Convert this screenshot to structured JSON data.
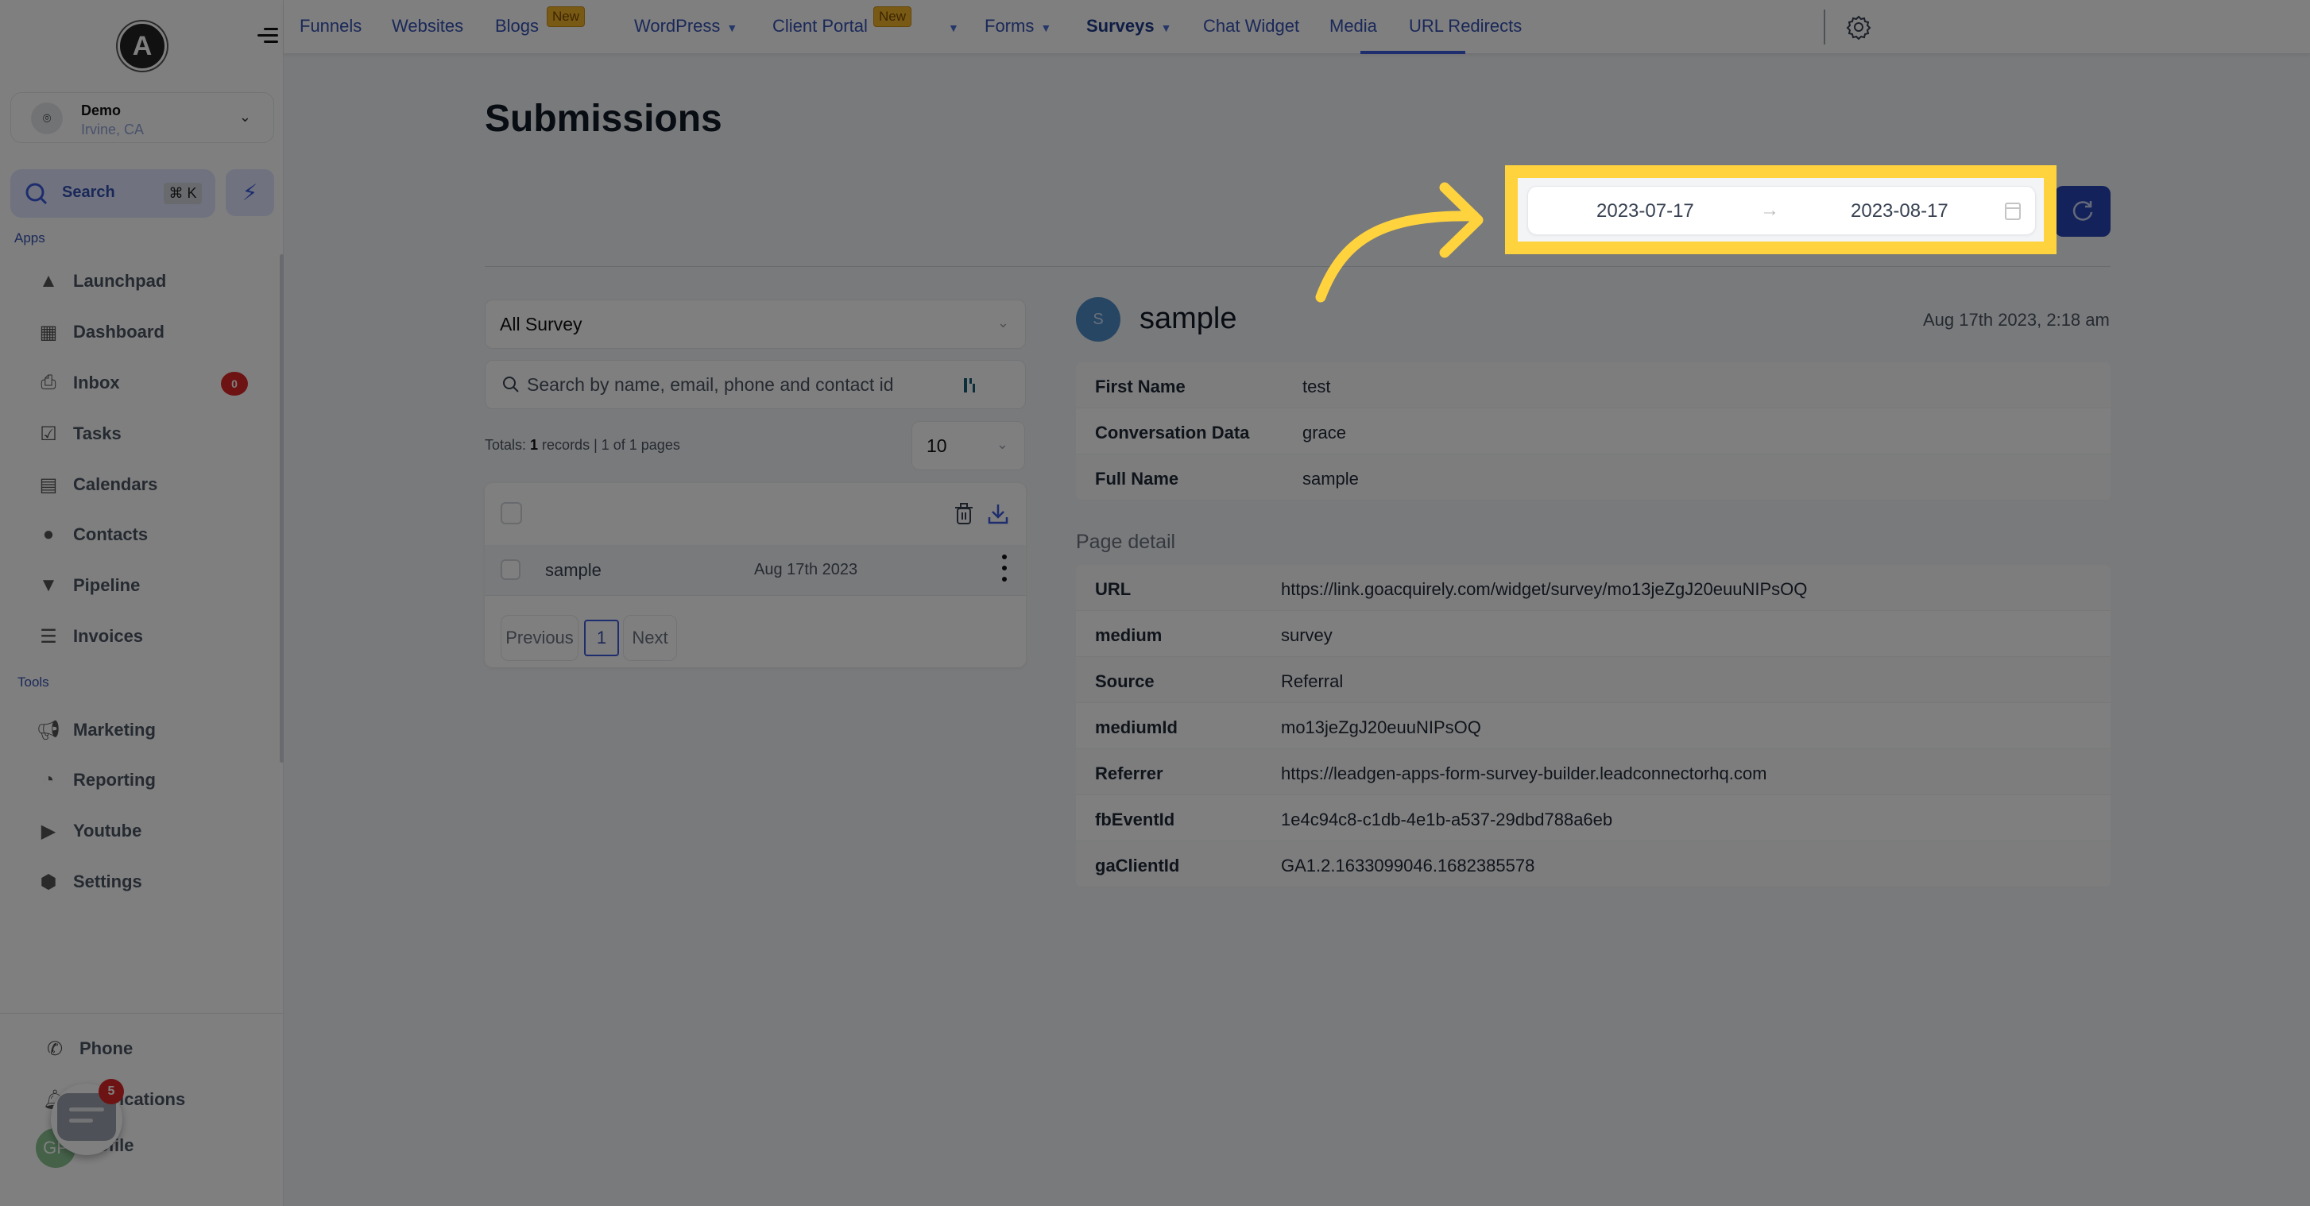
{
  "sidebar": {
    "logo_letter": "A",
    "account": {
      "name": "Demo",
      "location": "Irvine, CA"
    },
    "search": {
      "label": "Search",
      "shortcut": "⌘ K"
    },
    "apps_label": "Apps",
    "tools_label": "Tools",
    "apps": [
      {
        "label": "Launchpad",
        "icon": "rocket-icon"
      },
      {
        "label": "Dashboard",
        "icon": "dashboard-icon"
      },
      {
        "label": "Inbox",
        "icon": "inbox-icon",
        "badge": "0"
      },
      {
        "label": "Tasks",
        "icon": "clipboard-check-icon"
      },
      {
        "label": "Calendars",
        "icon": "calendar-icon"
      },
      {
        "label": "Contacts",
        "icon": "user-icon"
      },
      {
        "label": "Pipeline",
        "icon": "funnel-icon"
      },
      {
        "label": "Invoices",
        "icon": "invoice-icon"
      }
    ],
    "tools": [
      {
        "label": "Marketing",
        "icon": "megaphone-icon"
      },
      {
        "label": "Reporting",
        "icon": "pie-chart-icon"
      },
      {
        "label": "Youtube",
        "icon": "youtube-icon"
      },
      {
        "label": "Settings",
        "icon": "settings-icon"
      }
    ],
    "bottom": [
      {
        "label": "Phone",
        "icon": "phone-icon"
      },
      {
        "label": "Notifications",
        "icon": "bell-icon"
      },
      {
        "label": "Profile",
        "icon": "avatar"
      }
    ],
    "profile_initials": "GP",
    "chat_badge": "5"
  },
  "topnav": {
    "tabs": [
      {
        "label": "Funnels"
      },
      {
        "label": "Websites"
      },
      {
        "label": "Blogs",
        "badge": "New"
      },
      {
        "label": "WordPress",
        "dropdown": true
      },
      {
        "label": "Client Portal",
        "badge": "New",
        "dropdown": true
      },
      {
        "label": "Forms",
        "dropdown": true
      },
      {
        "label": "Surveys",
        "dropdown": true,
        "active": true
      },
      {
        "label": "Chat Widget"
      },
      {
        "label": "Media"
      },
      {
        "label": "URL Redirects"
      }
    ]
  },
  "main": {
    "title": "Submissions",
    "date_range": {
      "start": "2023-07-17",
      "end": "2023-08-17",
      "separator": "→"
    },
    "survey_filter": {
      "selected": "All Survey"
    },
    "search": {
      "placeholder": "Search by name, email, phone and contact id",
      "value": ""
    },
    "totals": {
      "prefix": "Totals: ",
      "count": "1",
      "suffix": " records | 1 of 1 pages"
    },
    "page_size": "10",
    "submissions": [
      {
        "name": "sample",
        "date": "Aug 17th 2023"
      }
    ],
    "pagination": {
      "previous": "Previous",
      "current": "1",
      "next": "Next"
    }
  },
  "detail": {
    "avatar_initial": "S",
    "name": "sample",
    "submitted_at": "Aug 17th 2023, 2:18 am",
    "fields": [
      {
        "key": "First Name",
        "value": "test"
      },
      {
        "key": "Conversation Data",
        "value": "grace"
      },
      {
        "key": "Full Name",
        "value": "sample"
      }
    ],
    "page_detail_label": "Page detail",
    "page_detail": [
      {
        "key": "URL",
        "value": "https://link.goacquirely.com/widget/survey/mo13jeZgJ20euuNIPsOQ"
      },
      {
        "key": "medium",
        "value": "survey"
      },
      {
        "key": "Source",
        "value": "Referral"
      },
      {
        "key": "mediumId",
        "value": "mo13jeZgJ20euuNIPsOQ"
      },
      {
        "key": "Referrer",
        "value": "https://leadgen-apps-form-survey-builder.leadconnectorhq.com"
      },
      {
        "key": "fbEventId",
        "value": "1e4c94c8-c1db-4e1b-a537-29dbd788a6eb"
      },
      {
        "key": "gaClientId",
        "value": "GA1.2.1633099046.1682385578"
      }
    ]
  },
  "colors": {
    "accent": "#3b5bdb",
    "refresh_button": "#2845b7",
    "highlight": "#ffd33d",
    "badge_red": "#dc2626",
    "new_badge": "#f2b52b"
  }
}
